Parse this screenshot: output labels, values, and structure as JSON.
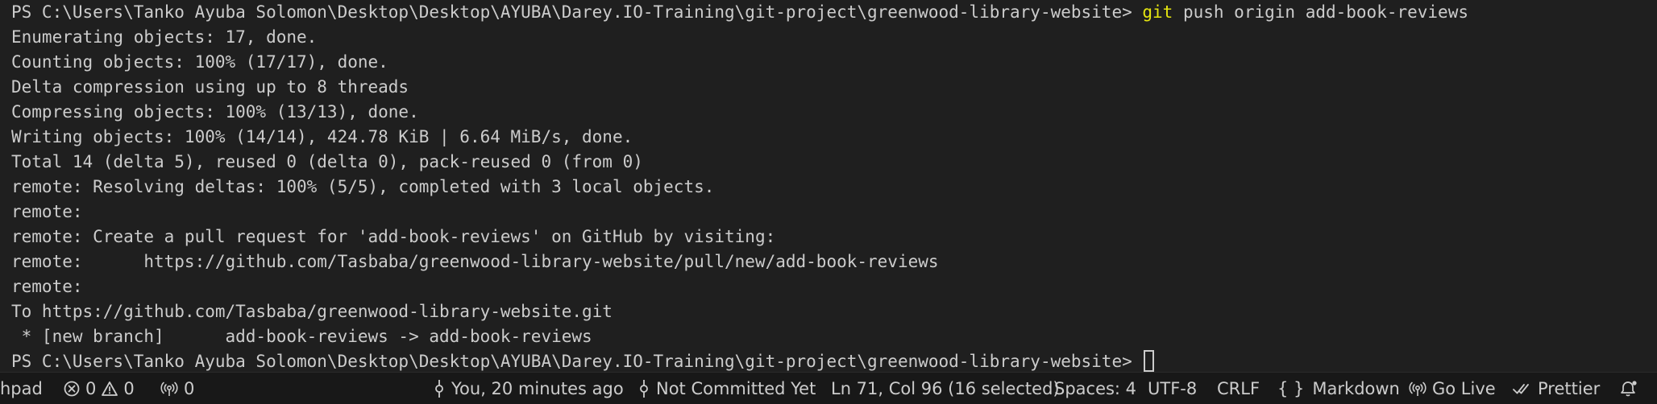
{
  "terminal": {
    "lines": [
      {
        "prompt": "PS C:\\Users\\Tanko Ayuba Solomon\\Desktop\\Desktop\\AYUBA\\Darey.IO-Training\\git-project\\greenwood-library-website> ",
        "command": "git",
        "args": " push origin add-book-reviews"
      },
      {
        "text": "Enumerating objects: 17, done."
      },
      {
        "text": "Counting objects: 100% (17/17), done."
      },
      {
        "text": "Delta compression using up to 8 threads"
      },
      {
        "text": "Compressing objects: 100% (13/13), done."
      },
      {
        "text": "Writing objects: 100% (14/14), 424.78 KiB | 6.64 MiB/s, done."
      },
      {
        "text": "Total 14 (delta 5), reused 0 (delta 0), pack-reused 0 (from 0)"
      },
      {
        "text": "remote: Resolving deltas: 100% (5/5), completed with 3 local objects."
      },
      {
        "text": "remote:"
      },
      {
        "text": "remote: Create a pull request for 'add-book-reviews' on GitHub by visiting:"
      },
      {
        "text": "remote:      https://github.com/Tasbaba/greenwood-library-website/pull/new/add-book-reviews"
      },
      {
        "text": "remote:"
      },
      {
        "text": "To https://github.com/Tasbaba/greenwood-library-website.git"
      },
      {
        "text": " * [new branch]      add-book-reviews -> add-book-reviews"
      },
      {
        "prompt": "PS C:\\Users\\Tanko Ayuba Solomon\\Desktop\\Desktop\\AYUBA\\Darey.IO-Training\\git-project\\greenwood-library-website> "
      }
    ]
  },
  "statusbar": {
    "workspace": "hpad",
    "errors": "0",
    "warnings": "0",
    "ports": "0",
    "blame": "You, 20 minutes ago",
    "commit": "Not Committed Yet",
    "cursor_position": "Ln 71, Col 96 (16 selected)",
    "indentation": "Spaces: 4",
    "encoding": "UTF-8",
    "eol": "CRLF",
    "language_icon": "{ }",
    "language": "Markdown",
    "go_live": "Go Live",
    "prettier": "Prettier"
  },
  "icons": {
    "errors": "error-circle-icon",
    "warnings": "warning-triangle-icon",
    "ports": "broadcast-icon",
    "blame": "git-commit-icon",
    "commit": "git-commit-icon",
    "go_live": "broadcast-icon",
    "prettier": "double-check-icon",
    "notifications": "bell-icon"
  },
  "colors": {
    "terminal_background": "#1f1f1f",
    "terminal_text": "#cccccc",
    "command_highlight": "#e5e510",
    "statusbar_background": "#181818"
  }
}
